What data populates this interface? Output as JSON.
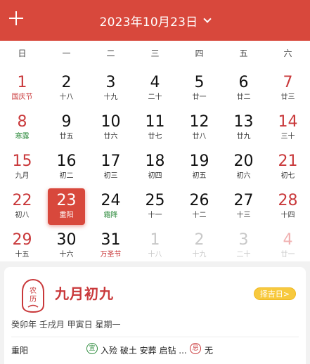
{
  "header": {
    "title": "2023年10月23日",
    "add_icon": "plus-icon",
    "dropdown_icon": "chevron-down-icon",
    "bg_color": "#d8483c"
  },
  "weekdays": [
    "日",
    "一",
    "二",
    "三",
    "四",
    "五",
    "六"
  ],
  "weeks": [
    [
      {
        "day": "1",
        "sub": "国庆节",
        "type": "holiday",
        "weekend": true
      },
      {
        "day": "2",
        "sub": "十八"
      },
      {
        "day": "3",
        "sub": "十九"
      },
      {
        "day": "4",
        "sub": "二十"
      },
      {
        "day": "5",
        "sub": "廿一"
      },
      {
        "day": "6",
        "sub": "廿二"
      },
      {
        "day": "7",
        "sub": "廿三",
        "weekend": true
      }
    ],
    [
      {
        "day": "8",
        "sub": "寒露",
        "type": "term",
        "weekend": true
      },
      {
        "day": "9",
        "sub": "廿五"
      },
      {
        "day": "10",
        "sub": "廿六"
      },
      {
        "day": "11",
        "sub": "廿七"
      },
      {
        "day": "12",
        "sub": "廿八"
      },
      {
        "day": "13",
        "sub": "廿九"
      },
      {
        "day": "14",
        "sub": "三十",
        "weekend": true
      }
    ],
    [
      {
        "day": "15",
        "sub": "九月",
        "weekend": true
      },
      {
        "day": "16",
        "sub": "初二"
      },
      {
        "day": "17",
        "sub": "初三"
      },
      {
        "day": "18",
        "sub": "初四"
      },
      {
        "day": "19",
        "sub": "初五"
      },
      {
        "day": "20",
        "sub": "初六"
      },
      {
        "day": "21",
        "sub": "初七",
        "weekend": true
      }
    ],
    [
      {
        "day": "22",
        "sub": "初八",
        "weekend": true
      },
      {
        "day": "23",
        "sub": "重阳",
        "selected": true
      },
      {
        "day": "24",
        "sub": "霜降",
        "type": "term"
      },
      {
        "day": "25",
        "sub": "十一"
      },
      {
        "day": "26",
        "sub": "十二"
      },
      {
        "day": "27",
        "sub": "十三"
      },
      {
        "day": "28",
        "sub": "十四",
        "weekend": true
      }
    ],
    [
      {
        "day": "29",
        "sub": "十五",
        "weekend": true
      },
      {
        "day": "30",
        "sub": "十六"
      },
      {
        "day": "31",
        "sub": "万圣节",
        "type": "holiday"
      },
      {
        "day": "1",
        "sub": "十八",
        "other": true
      },
      {
        "day": "2",
        "sub": "十九",
        "other": true
      },
      {
        "day": "3",
        "sub": "二十",
        "other": true
      },
      {
        "day": "4",
        "sub": "廿一",
        "other": true,
        "weekend": true
      }
    ]
  ],
  "detail": {
    "seal_text": "农历",
    "seal_icon": "lunar-seal-icon",
    "lunar_date": "九月初九",
    "pick_button": "择吉日>",
    "ganzhi": "癸卯年 壬戌月 甲寅日 星期一",
    "festival": "重阳",
    "yi_label": "宜",
    "yi_text": "入殓 破土 安葬 启钻 ...",
    "ji_label": "忌",
    "ji_text": "无"
  }
}
